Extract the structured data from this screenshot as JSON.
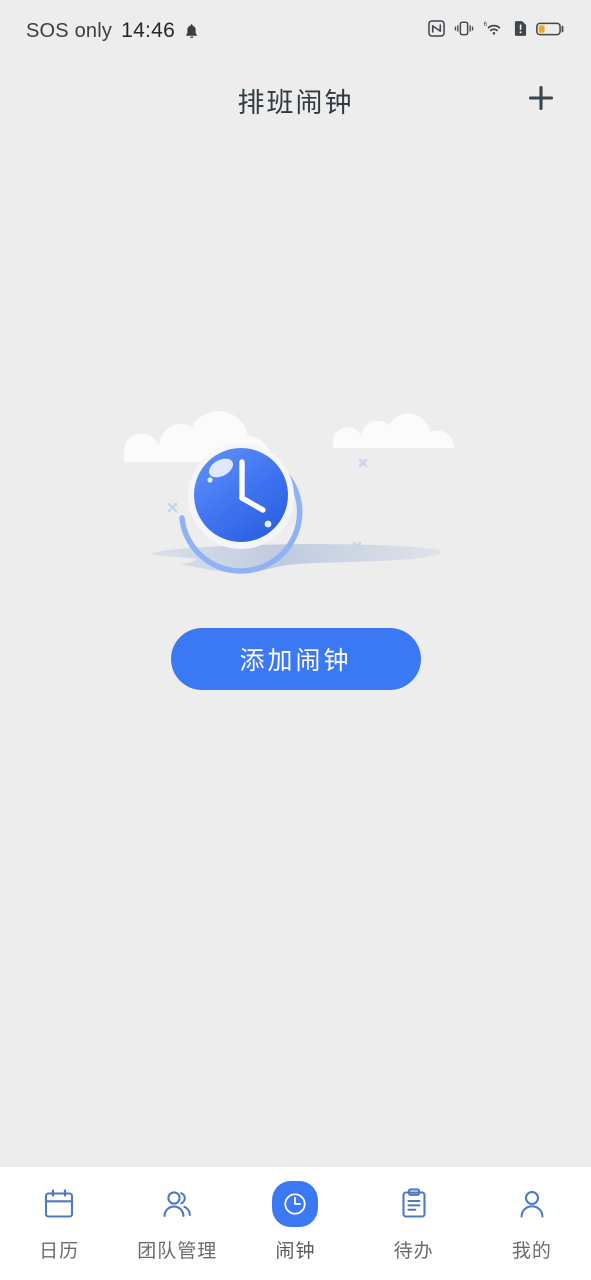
{
  "status_bar": {
    "carrier": "SOS only",
    "time": "14:46",
    "bell_icon": "bell-icon",
    "right_icons": [
      "nfc-icon",
      "vibrate-icon",
      "wifi-6-icon",
      "sim-alert-icon",
      "battery-low-icon"
    ]
  },
  "header": {
    "title": "排班闹钟",
    "add_icon": "plus-icon"
  },
  "empty_state": {
    "illustration": "clock-clouds-illustration",
    "add_alarm_label": "添加闹钟"
  },
  "tabbar": {
    "items": [
      {
        "label": "日历",
        "icon": "calendar-icon",
        "active": false
      },
      {
        "label": "团队管理",
        "icon": "people-icon",
        "active": false
      },
      {
        "label": "闹钟",
        "icon": "clock-icon",
        "active": true
      },
      {
        "label": "待办",
        "icon": "clipboard-icon",
        "active": false
      },
      {
        "label": "我的",
        "icon": "person-icon",
        "active": false
      }
    ]
  },
  "colors": {
    "background": "#ededed",
    "accent": "#3b78f3",
    "accent_dark": "#2f62e0",
    "title": "#2f3a41",
    "tab_label": "#6b6b6b",
    "nav_background": "#ffffff",
    "icon_outline": "#5a7fc4"
  }
}
